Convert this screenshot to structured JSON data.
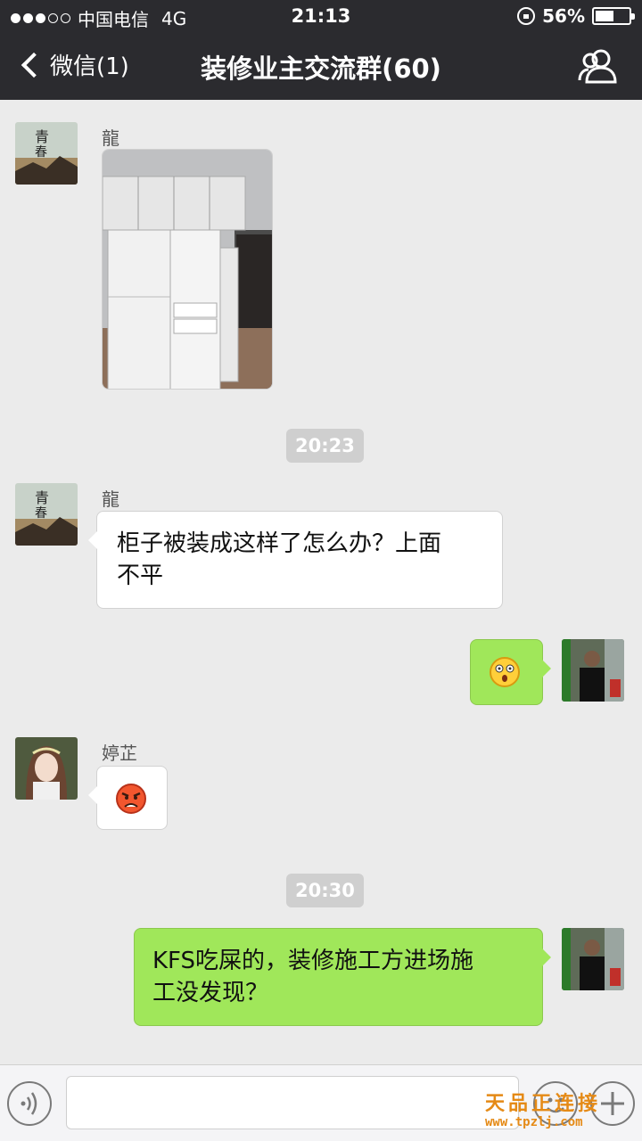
{
  "status_bar": {
    "carrier": "中国电信",
    "network": "4G",
    "time": "21:13",
    "battery": "56%",
    "battery_level": 0.56
  },
  "navbar": {
    "back_label": "微信(1)",
    "title": "装修业主交流群(60)"
  },
  "messages": [
    {
      "sender": "龍",
      "type": "image",
      "content": "wardrobe photo"
    },
    {
      "timestamp": "20:23"
    },
    {
      "sender": "龍",
      "text": "柜子被装成这样了怎么办？上面不平",
      "line1": "柜子被装成这样了怎么办？上面",
      "line2": "不平"
    },
    {
      "sender": "me",
      "type": "emoji",
      "emoji": "shocked-face"
    },
    {
      "sender": "婷芷",
      "type": "emoji",
      "emoji": "angry-face"
    },
    {
      "timestamp": "20:30"
    },
    {
      "sender": "me",
      "text": "KFS吃屎的，装修施工方进场施工没发现？",
      "line1": "KFS吃屎的，装修施工方进场施",
      "line2": "工没发现？"
    }
  ],
  "watermark": {
    "text": "天品正连接",
    "url": "www.tpzlj.com"
  },
  "colors": {
    "header_bg": "#2b2b2f",
    "chat_bg": "#ebebeb",
    "outgoing_bubble": "#a0e75a",
    "incoming_bubble": "#ffffff",
    "watermark": "#e58a16"
  }
}
